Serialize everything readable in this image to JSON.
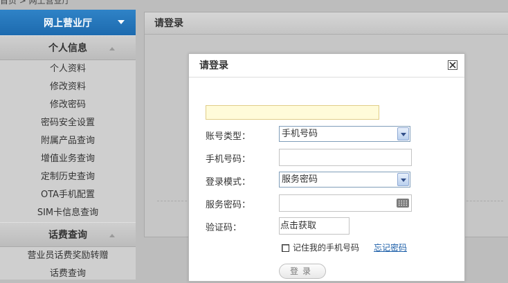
{
  "breadcrumb": "首页 > 网上营业厅",
  "sidebar": {
    "top_label": "网上营业厅",
    "section1": {
      "title": "个人信息",
      "items": [
        "个人资料",
        "修改资料",
        "修改密码",
        "密码安全设置",
        "附属产品查询",
        "增值业务查询",
        "定制历史查询",
        "OTA手机配置",
        "SIM卡信息查询"
      ]
    },
    "section2": {
      "title": "话费查询",
      "items": [
        "营业员话费奖励转赠",
        "话费查询"
      ]
    }
  },
  "panel": {
    "title": "请登录"
  },
  "modal": {
    "title": "请登录",
    "account_type_label": "账号类型：",
    "account_type_value": "手机号码",
    "phone_label": "手机号码：",
    "phone_value": "",
    "login_mode_label": "登录模式：",
    "login_mode_value": "服务密码",
    "password_label": "服务密码：",
    "password_value": "",
    "captcha_label": "验证码：",
    "captcha_button": "点击获取",
    "remember_label": "记住我的手机号码",
    "forgot_link": "忘记密码",
    "login_button": "登录"
  },
  "icons": {
    "close": "close-icon",
    "keyboard": "keyboard-icon",
    "dropdown": "chevron-down-icon"
  }
}
